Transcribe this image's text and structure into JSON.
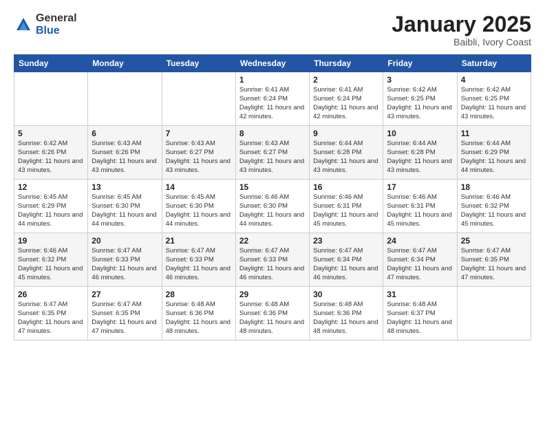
{
  "logo": {
    "general": "General",
    "blue": "Blue"
  },
  "header": {
    "month": "January 2025",
    "location": "Baibli, Ivory Coast"
  },
  "weekdays": [
    "Sunday",
    "Monday",
    "Tuesday",
    "Wednesday",
    "Thursday",
    "Friday",
    "Saturday"
  ],
  "weeks": [
    [
      {
        "day": "",
        "info": ""
      },
      {
        "day": "",
        "info": ""
      },
      {
        "day": "",
        "info": ""
      },
      {
        "day": "1",
        "info": "Sunrise: 6:41 AM\nSunset: 6:24 PM\nDaylight: 11 hours\nand 42 minutes."
      },
      {
        "day": "2",
        "info": "Sunrise: 6:41 AM\nSunset: 6:24 PM\nDaylight: 11 hours\nand 42 minutes."
      },
      {
        "day": "3",
        "info": "Sunrise: 6:42 AM\nSunset: 6:25 PM\nDaylight: 11 hours\nand 43 minutes."
      },
      {
        "day": "4",
        "info": "Sunrise: 6:42 AM\nSunset: 6:25 PM\nDaylight: 11 hours\nand 43 minutes."
      }
    ],
    [
      {
        "day": "5",
        "info": "Sunrise: 6:42 AM\nSunset: 6:26 PM\nDaylight: 11 hours\nand 43 minutes."
      },
      {
        "day": "6",
        "info": "Sunrise: 6:43 AM\nSunset: 6:26 PM\nDaylight: 11 hours\nand 43 minutes."
      },
      {
        "day": "7",
        "info": "Sunrise: 6:43 AM\nSunset: 6:27 PM\nDaylight: 11 hours\nand 43 minutes."
      },
      {
        "day": "8",
        "info": "Sunrise: 6:43 AM\nSunset: 6:27 PM\nDaylight: 11 hours\nand 43 minutes."
      },
      {
        "day": "9",
        "info": "Sunrise: 6:44 AM\nSunset: 6:28 PM\nDaylight: 11 hours\nand 43 minutes."
      },
      {
        "day": "10",
        "info": "Sunrise: 6:44 AM\nSunset: 6:28 PM\nDaylight: 11 hours\nand 43 minutes."
      },
      {
        "day": "11",
        "info": "Sunrise: 6:44 AM\nSunset: 6:29 PM\nDaylight: 11 hours\nand 44 minutes."
      }
    ],
    [
      {
        "day": "12",
        "info": "Sunrise: 6:45 AM\nSunset: 6:29 PM\nDaylight: 11 hours\nand 44 minutes."
      },
      {
        "day": "13",
        "info": "Sunrise: 6:45 AM\nSunset: 6:30 PM\nDaylight: 11 hours\nand 44 minutes."
      },
      {
        "day": "14",
        "info": "Sunrise: 6:45 AM\nSunset: 6:30 PM\nDaylight: 11 hours\nand 44 minutes."
      },
      {
        "day": "15",
        "info": "Sunrise: 6:46 AM\nSunset: 6:30 PM\nDaylight: 11 hours\nand 44 minutes."
      },
      {
        "day": "16",
        "info": "Sunrise: 6:46 AM\nSunset: 6:31 PM\nDaylight: 11 hours\nand 45 minutes."
      },
      {
        "day": "17",
        "info": "Sunrise: 6:46 AM\nSunset: 6:31 PM\nDaylight: 11 hours\nand 45 minutes."
      },
      {
        "day": "18",
        "info": "Sunrise: 6:46 AM\nSunset: 6:32 PM\nDaylight: 11 hours\nand 45 minutes."
      }
    ],
    [
      {
        "day": "19",
        "info": "Sunrise: 6:46 AM\nSunset: 6:32 PM\nDaylight: 11 hours\nand 45 minutes."
      },
      {
        "day": "20",
        "info": "Sunrise: 6:47 AM\nSunset: 6:33 PM\nDaylight: 11 hours\nand 46 minutes."
      },
      {
        "day": "21",
        "info": "Sunrise: 6:47 AM\nSunset: 6:33 PM\nDaylight: 11 hours\nand 46 minutes."
      },
      {
        "day": "22",
        "info": "Sunrise: 6:47 AM\nSunset: 6:33 PM\nDaylight: 11 hours\nand 46 minutes."
      },
      {
        "day": "23",
        "info": "Sunrise: 6:47 AM\nSunset: 6:34 PM\nDaylight: 11 hours\nand 46 minutes."
      },
      {
        "day": "24",
        "info": "Sunrise: 6:47 AM\nSunset: 6:34 PM\nDaylight: 11 hours\nand 47 minutes."
      },
      {
        "day": "25",
        "info": "Sunrise: 6:47 AM\nSunset: 6:35 PM\nDaylight: 11 hours\nand 47 minutes."
      }
    ],
    [
      {
        "day": "26",
        "info": "Sunrise: 6:47 AM\nSunset: 6:35 PM\nDaylight: 11 hours\nand 47 minutes."
      },
      {
        "day": "27",
        "info": "Sunrise: 6:47 AM\nSunset: 6:35 PM\nDaylight: 11 hours\nand 47 minutes."
      },
      {
        "day": "28",
        "info": "Sunrise: 6:48 AM\nSunset: 6:36 PM\nDaylight: 11 hours\nand 48 minutes."
      },
      {
        "day": "29",
        "info": "Sunrise: 6:48 AM\nSunset: 6:36 PM\nDaylight: 11 hours\nand 48 minutes."
      },
      {
        "day": "30",
        "info": "Sunrise: 6:48 AM\nSunset: 6:36 PM\nDaylight: 11 hours\nand 48 minutes."
      },
      {
        "day": "31",
        "info": "Sunrise: 6:48 AM\nSunset: 6:37 PM\nDaylight: 11 hours\nand 48 minutes."
      },
      {
        "day": "",
        "info": ""
      }
    ]
  ]
}
